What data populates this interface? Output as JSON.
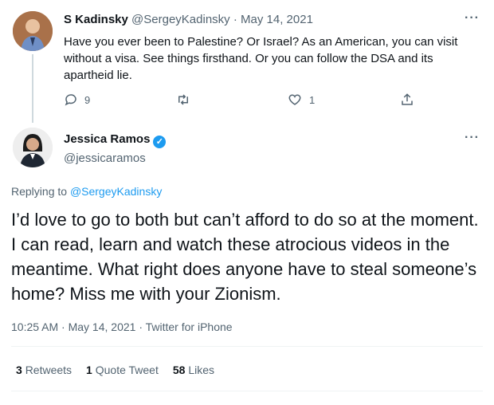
{
  "reply_tweet": {
    "display_name": "S Kadinsky",
    "handle": "@SergeyKadinsky",
    "separator": "·",
    "date": "May 14, 2021",
    "more": "···",
    "text": "Have you ever been to Palestine? Or Israel? As an American, you can visit without a visa. See things firsthand. Or you can follow the DSA and its apartheid lie.",
    "reply_count": "9",
    "like_count": "1"
  },
  "main_tweet": {
    "display_name": "Jessica Ramos",
    "handle": "@jessicaramos",
    "more": "···",
    "replying_label": "Replying to ",
    "replying_handle": "@SergeyKadinsky",
    "text": "I’d love to go to both but can’t afford to do so at the moment. I can read, learn and watch these atrocious videos in the meantime. What right does anyone have to steal someone’s home? Miss me with your Zionism.",
    "meta": "10:25 AM · May 14, 2021 · Twitter for iPhone",
    "stats": {
      "retweets_count": "3",
      "retweets_label": "Retweets",
      "quotes_count": "1",
      "quotes_label": "Quote Tweet",
      "likes_count": "58",
      "likes_label": "Likes"
    }
  },
  "colors": {
    "accent": "#1d9bf0",
    "muted": "#536471",
    "text": "#0f1419"
  },
  "icons": [
    "reply-icon",
    "retweet-icon",
    "like-icon",
    "share-icon",
    "verified-badge-icon"
  ]
}
